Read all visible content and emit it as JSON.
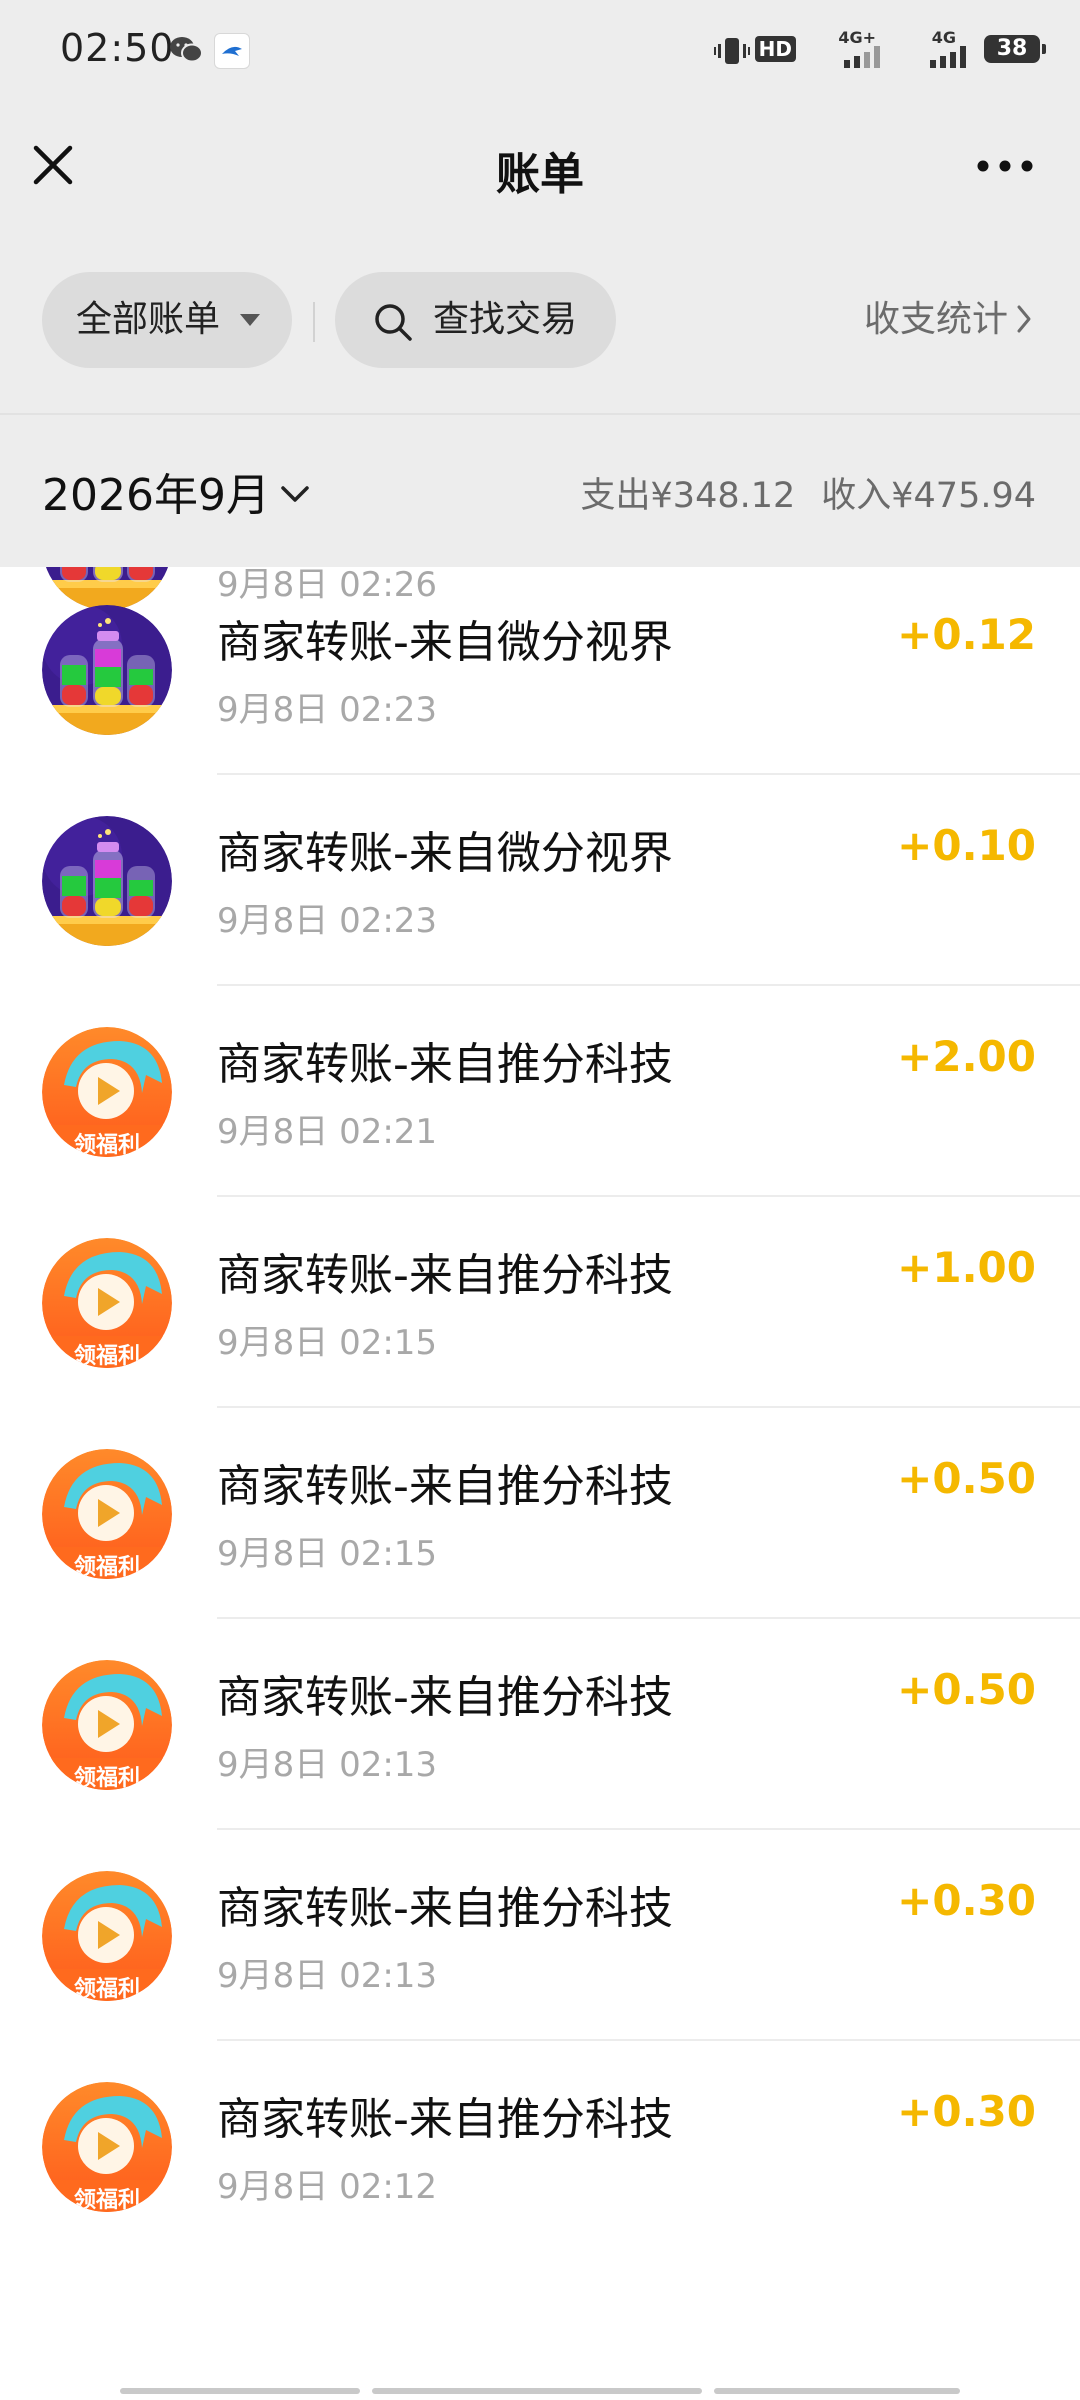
{
  "status": {
    "time": "02:50",
    "hd_label": "HD",
    "net1": "4G+",
    "net2": "4G",
    "battery": "38"
  },
  "nav": {
    "title": "账单"
  },
  "filters": {
    "all_bills_label": "全部账单",
    "search_label": "查找交易",
    "stats_label": "收支统计"
  },
  "month": {
    "label": "2026年9月",
    "expense": "支出¥348.12",
    "income": "收入¥475.94"
  },
  "icons": {
    "close": "close-icon",
    "more": "more-icon",
    "search": "search-icon",
    "dropdown": "caret-down-icon",
    "chevron": "chevron-right-icon"
  },
  "colors": {
    "amount_positive": "#f5b800",
    "header_bg": "#ededed"
  },
  "transactions": [
    {
      "title": "",
      "time": "9月8日 02:26",
      "amount": "",
      "avatar": "bottles"
    },
    {
      "title": "商家转账-来自微分视界",
      "time": "9月8日 02:23",
      "amount": "+0.12",
      "avatar": "bottles"
    },
    {
      "title": "商家转账-来自微分视界",
      "time": "9月8日 02:23",
      "amount": "+0.10",
      "avatar": "bottles"
    },
    {
      "title": "商家转账-来自推分科技",
      "time": "9月8日 02:21",
      "amount": "+2.00",
      "avatar": "play"
    },
    {
      "title": "商家转账-来自推分科技",
      "time": "9月8日 02:15",
      "amount": "+1.00",
      "avatar": "play"
    },
    {
      "title": "商家转账-来自推分科技",
      "time": "9月8日 02:15",
      "amount": "+0.50",
      "avatar": "play"
    },
    {
      "title": "商家转账-来自推分科技",
      "time": "9月8日 02:13",
      "amount": "+0.50",
      "avatar": "play"
    },
    {
      "title": "商家转账-来自推分科技",
      "time": "9月8日 02:13",
      "amount": "+0.30",
      "avatar": "play"
    },
    {
      "title": "商家转账-来自推分科技",
      "time": "9月8日 02:12",
      "amount": "+0.30",
      "avatar": "play"
    }
  ],
  "avatar_text": {
    "play": "领福利"
  }
}
